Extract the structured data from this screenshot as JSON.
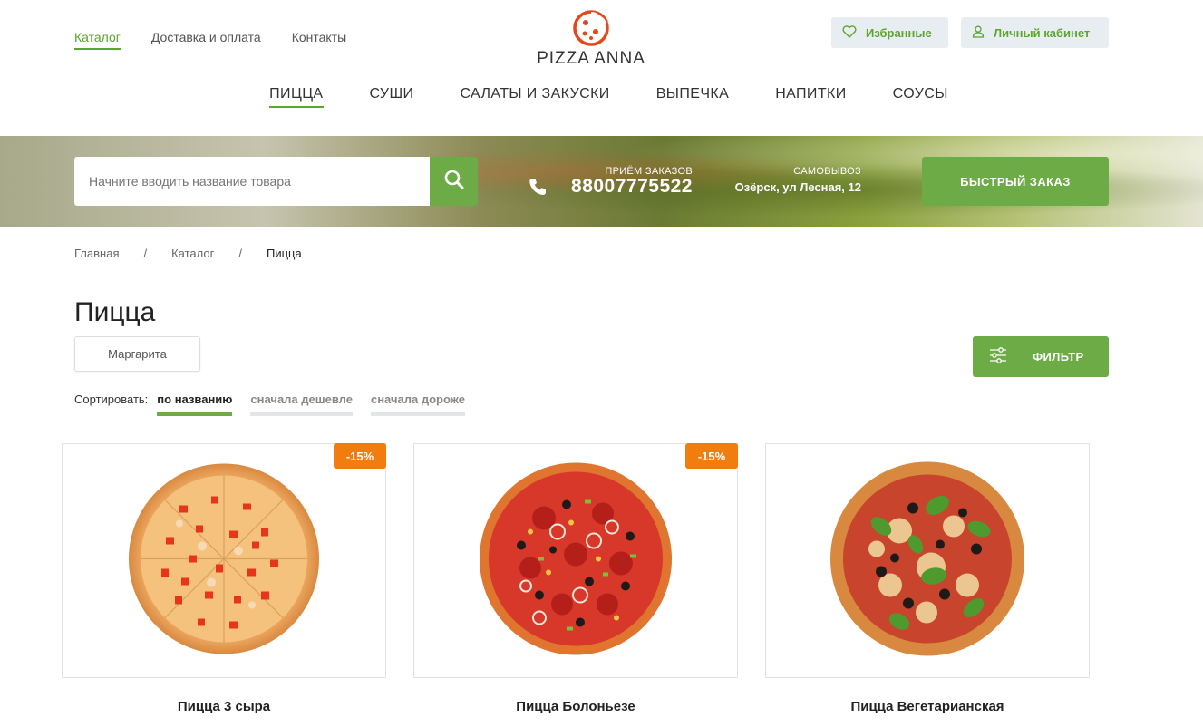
{
  "header": {
    "top_links": [
      "Каталог",
      "Доставка и оплата",
      "Контакты"
    ],
    "logo_text": "PIZZA ANNA",
    "favorites_label": "Избранные",
    "account_label": "Личный кабинет"
  },
  "categories": [
    "ПИЦЦА",
    "СУШИ",
    "САЛАТЫ И ЗАКУСКИ",
    "ВЫПЕЧКА",
    "НАПИТКИ",
    "СОУСЫ"
  ],
  "banner": {
    "search_placeholder": "Начните вводить название товара",
    "orders_caption": "ПРИЁМ ЗАКАЗОВ",
    "phone": "88007775522",
    "pickup_caption": "САМОВЫВОЗ",
    "pickup_address": "Озёрск, ул Лесная, 12",
    "quick_order_label": "БЫСТРЫЙ ЗАКАЗ"
  },
  "breadcrumbs": [
    "Главная",
    "Каталог",
    "Пицца"
  ],
  "page": {
    "title": "Пицца",
    "tag": "Маргарита",
    "filter_label": "ФИЛЬТР",
    "sort_label": "Сортировать:",
    "sort_options": [
      "по названию",
      "сначала дешевле",
      "сначала дороже"
    ]
  },
  "products": [
    {
      "name": "Пицца 3 сыра",
      "badge": "-15%"
    },
    {
      "name": "Пицца Болоньезе",
      "badge": "-15%"
    },
    {
      "name": "Пицца Вегетарианская",
      "badge": ""
    }
  ],
  "colors": {
    "accent": "#6cab45",
    "badge": "#f07d0e"
  }
}
